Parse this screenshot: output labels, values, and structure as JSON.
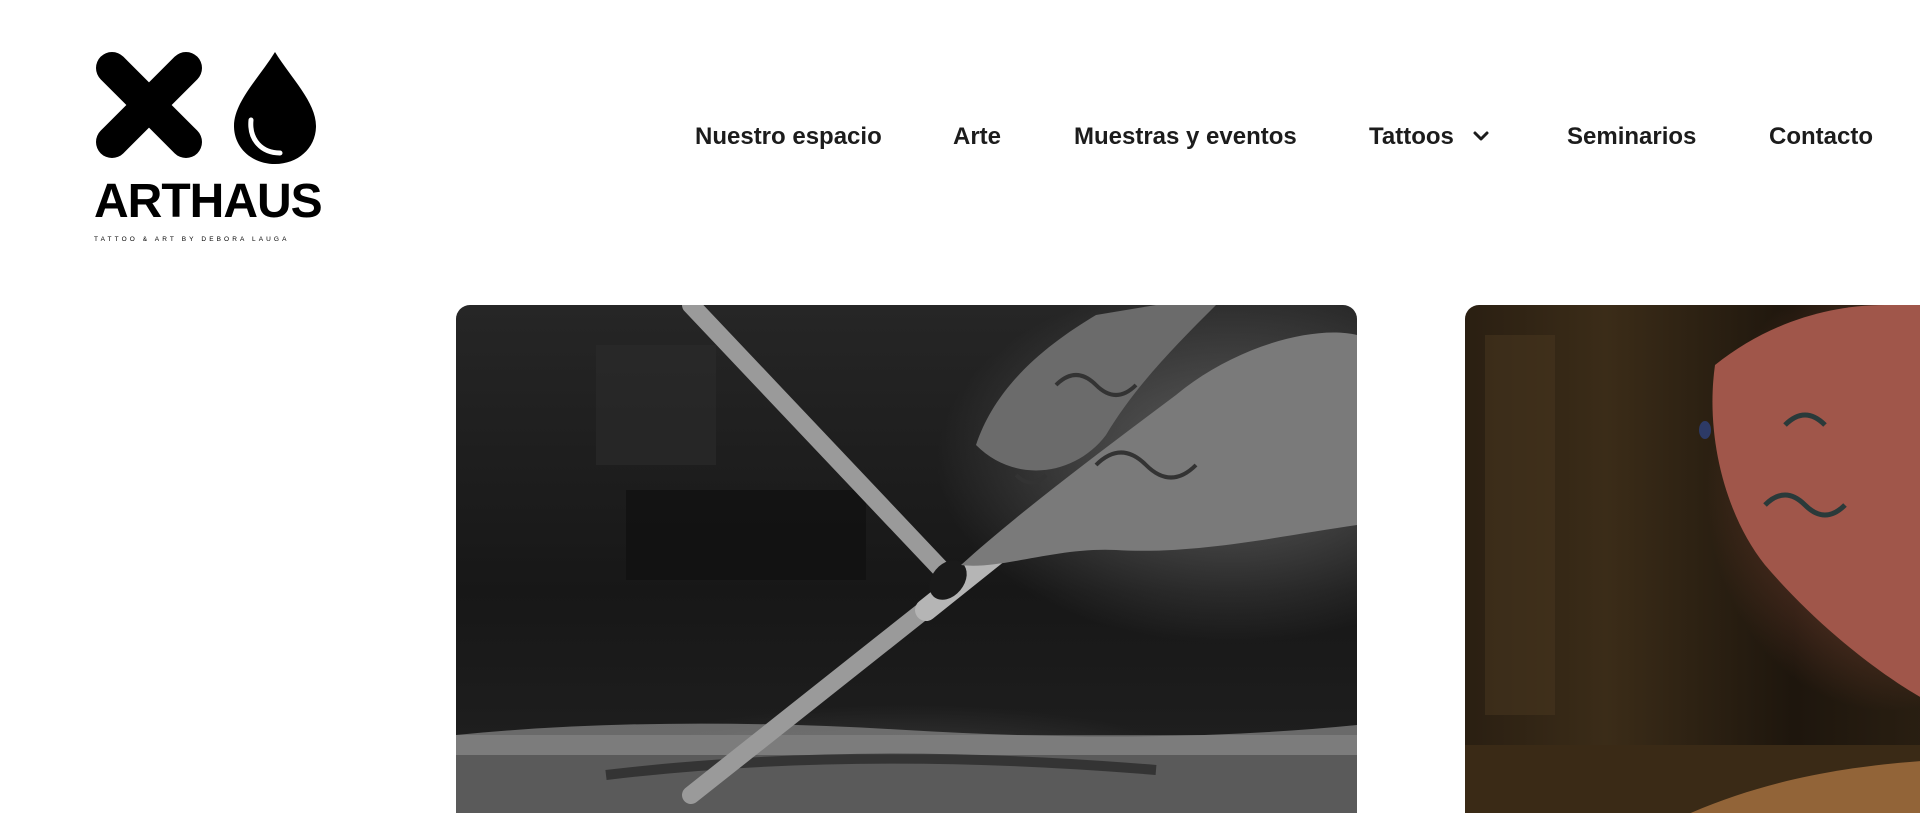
{
  "brand": {
    "name": "ARTHAUS",
    "tagline": "TATTOO & ART BY DEBORA LAUGA",
    "logo_icons": [
      "cross-icon",
      "drop-icon"
    ]
  },
  "nav": {
    "items": [
      {
        "label": "Nuestro espacio"
      },
      {
        "label": "Arte"
      },
      {
        "label": "Muestras y eventos"
      },
      {
        "label": "Tattoos",
        "has_dropdown": true,
        "dropdown_icon": "chevron-down-icon"
      },
      {
        "label": "Seminarios"
      },
      {
        "label": "Contacto"
      }
    ]
  },
  "gallery": {
    "slides": [
      {
        "subject": "tattooed hand holding brush over textured surface",
        "style": "black and white"
      },
      {
        "subject": "tattooed hand working on artwork",
        "style": "color"
      }
    ]
  },
  "colors": {
    "text": "#1c1c1c",
    "background": "#ffffff",
    "logo": "#000000"
  }
}
